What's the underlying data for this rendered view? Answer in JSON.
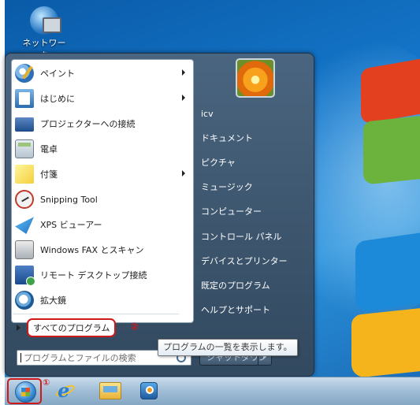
{
  "desktop": {
    "icons": [
      {
        "label": "ネットワーク",
        "icon": "network-icon"
      }
    ]
  },
  "start_menu": {
    "programs": [
      {
        "label": "ペイント",
        "icon": "paint-icon",
        "has_submenu": true
      },
      {
        "label": "はじめに",
        "icon": "getting-started-icon",
        "has_submenu": true
      },
      {
        "label": "プロジェクターへの接続",
        "icon": "projector-icon",
        "has_submenu": false
      },
      {
        "label": "電卓",
        "icon": "calculator-icon",
        "has_submenu": false
      },
      {
        "label": "付箋",
        "icon": "sticky-notes-icon",
        "has_submenu": true
      },
      {
        "label": "Snipping Tool",
        "icon": "snipping-tool-icon",
        "has_submenu": false
      },
      {
        "label": "XPS ビューアー",
        "icon": "xps-viewer-icon",
        "has_submenu": false
      },
      {
        "label": "Windows FAX とスキャン",
        "icon": "fax-scan-icon",
        "has_submenu": false
      },
      {
        "label": "リモート デスクトップ接続",
        "icon": "remote-desktop-icon",
        "has_submenu": false
      },
      {
        "label": "拡大鏡",
        "icon": "magnifier-icon",
        "has_submenu": false
      }
    ],
    "all_programs_label": "すべてのプログラム",
    "all_programs_marker": "②",
    "search_placeholder": "プログラムとファイルの検索",
    "right_items": [
      "icv",
      "ドキュメント",
      "ピクチャ",
      "ミュージック",
      "コンピューター",
      "コントロール パネル",
      "デバイスとプリンター",
      "既定のプログラム",
      "ヘルプとサポート"
    ],
    "shutdown_label": "シャットダウン",
    "tooltip": "プログラムの一覧を表示します。"
  },
  "taskbar": {
    "start_marker": "①",
    "pinned": [
      "internet-explorer-icon",
      "explorer-folder-icon",
      "media-player-icon"
    ]
  },
  "colors": {
    "highlight_red": "#d01818",
    "menu_dark": "#32495f",
    "desktop_blue": "#1578cc"
  }
}
